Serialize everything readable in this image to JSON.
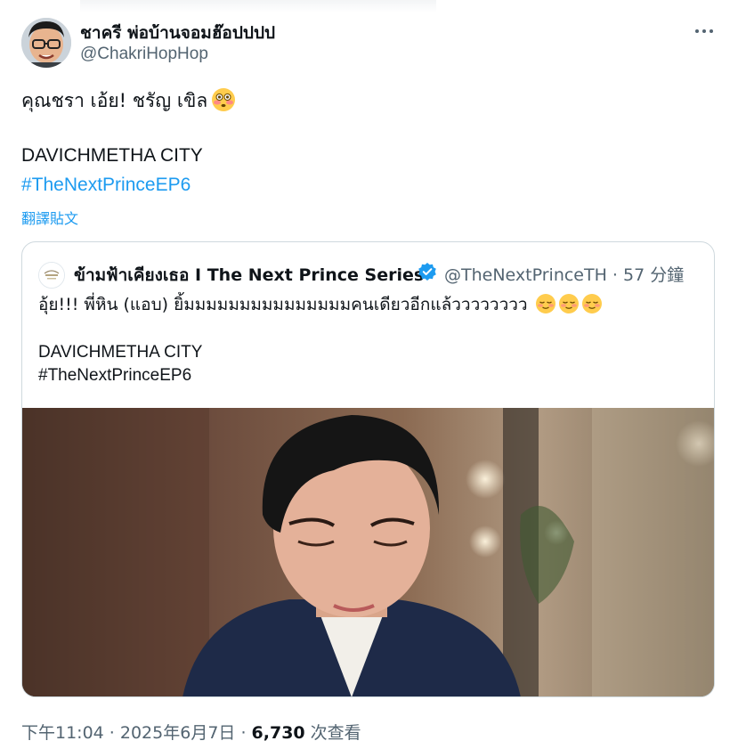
{
  "author": {
    "name": "ชาครี พ่อบ้านจอมฮ๊อปปปป",
    "handle": "@ChakriHopHop"
  },
  "tweet": {
    "line1": "คุณชรา เอ้ย! ชรัญ เขิล",
    "line1_emoji": "flushed-face",
    "brand": "DAVICHMETHA CITY",
    "hashtag": "#TheNextPrinceEP6",
    "translate_label": "翻譯貼文"
  },
  "quoted": {
    "name": "ข้ามฟ้าเคียงเธอ I The Next Prince Series",
    "verified": true,
    "handle_time": "@TheNextPrinceTH · 57 分鐘",
    "text": "อุ้ย!!! พี่หิน (แอบ) ยิ้มมมมมมมมมมมมมมมคนเดียวอีกแล้วววววววว",
    "text_emojis": [
      "relieved-face",
      "relieved-face",
      "relieved-face"
    ],
    "brand": "DAVICHMETHA CITY",
    "hashtag": "#TheNextPrinceEP6"
  },
  "footer": {
    "timestamp": "下午11:04 · 2025年6月7日 · ",
    "views": "6,730",
    "views_label": " 次查看"
  },
  "colors": {
    "link": "#1d9bf0",
    "secondary_text": "#536471",
    "primary_text": "#0f1419",
    "border": "#cfd9de",
    "verified": "#1d9bf0"
  }
}
